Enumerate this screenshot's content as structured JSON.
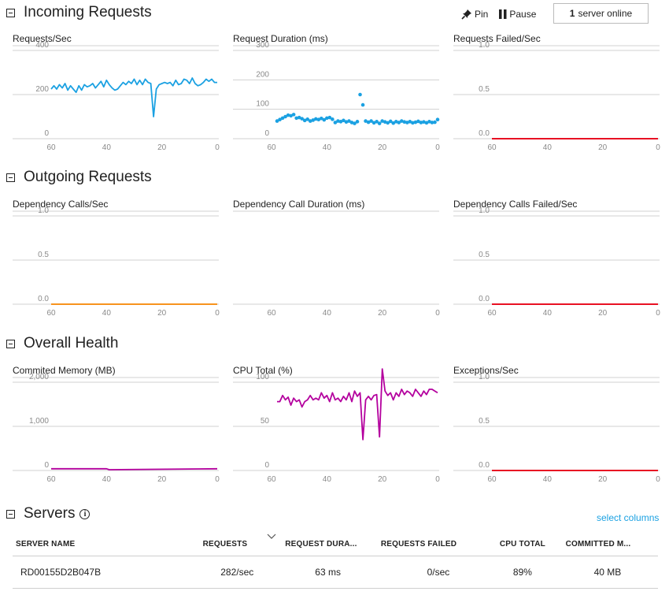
{
  "sections": {
    "incoming": "Incoming Requests",
    "outgoing": "Outgoing Requests",
    "health": "Overall Health",
    "servers": "Servers"
  },
  "toolbar": {
    "pin_label": "Pin",
    "pause_label": "Pause",
    "server_count": "1",
    "server_text": "server online"
  },
  "servers_panel": {
    "info_icon": "i",
    "select_columns": "select columns",
    "columns": [
      "SERVER NAME",
      "REQUESTS",
      "REQUEST DURA...",
      "REQUESTS FAILED",
      "CPU TOTAL",
      "COMMITTED M..."
    ],
    "rows": [
      [
        "RD00155D2B047B",
        "282/sec",
        "63 ms",
        "0/sec",
        "89%",
        "40 MB"
      ]
    ]
  },
  "colors": {
    "blue": "#1ba1e2",
    "orange": "#f7931e",
    "red": "#e81123",
    "purple": "#b4009e"
  },
  "chart_data": [
    {
      "id": "req-sec",
      "type": "line",
      "title": "Requests/Sec",
      "color": "#1ba1e2",
      "yticks": [
        "400",
        "200",
        "0"
      ],
      "ytick_values": [
        400,
        200,
        0
      ],
      "ylim": [
        0,
        400
      ],
      "xticks": [
        "60",
        "40",
        "20",
        "0"
      ],
      "xlim": [
        60,
        0
      ],
      "x": [
        60,
        59,
        58,
        57,
        56,
        55,
        54,
        53,
        52,
        51,
        50,
        49,
        48,
        47,
        46,
        45,
        44,
        43,
        42,
        41,
        40,
        39,
        38,
        37,
        36,
        35,
        34,
        33,
        32,
        31,
        30,
        29,
        28,
        27,
        26,
        25,
        24,
        23,
        22,
        21,
        20,
        19,
        18,
        17,
        16,
        15,
        14,
        13,
        12,
        11,
        10,
        9,
        8,
        7,
        6,
        5,
        4,
        3,
        2,
        1,
        0
      ],
      "values": [
        225,
        240,
        225,
        245,
        230,
        250,
        220,
        240,
        225,
        210,
        240,
        220,
        245,
        235,
        240,
        250,
        230,
        245,
        260,
        235,
        265,
        245,
        230,
        220,
        225,
        240,
        255,
        245,
        260,
        250,
        270,
        245,
        265,
        245,
        270,
        255,
        250,
        100,
        225,
        245,
        250,
        255,
        250,
        255,
        240,
        265,
        245,
        250,
        270,
        265,
        250,
        275,
        250,
        240,
        245,
        255,
        270,
        260,
        270,
        255,
        255
      ]
    },
    {
      "id": "req-dur",
      "type": "scatter",
      "title": "Request Duration (ms)",
      "color": "#1ba1e2",
      "yticks": [
        "300",
        "200",
        "100",
        "0"
      ],
      "ytick_values": [
        300,
        200,
        100,
        0
      ],
      "ylim": [
        0,
        300
      ],
      "xticks": [
        "60",
        "40",
        "20",
        "0"
      ],
      "xlim": [
        60,
        0
      ],
      "x": [
        58,
        57,
        56,
        55,
        54,
        53,
        52,
        51,
        50,
        49,
        48,
        47,
        46,
        45,
        44,
        43,
        42,
        41,
        40,
        39,
        38,
        37,
        36,
        35,
        34,
        33,
        32,
        31,
        30,
        29,
        28,
        27,
        26,
        25,
        24,
        23,
        22,
        21,
        20,
        19,
        18,
        17,
        16,
        15,
        14,
        13,
        12,
        11,
        10,
        9,
        8,
        7,
        6,
        5,
        4,
        3,
        2,
        1,
        0
      ],
      "values": [
        60,
        65,
        70,
        75,
        80,
        78,
        82,
        70,
        72,
        68,
        62,
        66,
        60,
        63,
        67,
        65,
        69,
        64,
        70,
        72,
        66,
        55,
        60,
        58,
        62,
        57,
        60,
        55,
        52,
        58,
        150,
        115,
        60,
        56,
        60,
        54,
        58,
        52,
        60,
        57,
        54,
        59,
        53,
        58,
        55,
        60,
        57,
        55,
        58,
        54,
        56,
        59,
        55,
        57,
        54,
        58,
        55,
        56,
        65
      ]
    },
    {
      "id": "req-failed",
      "type": "line",
      "title": "Requests Failed/Sec",
      "color": "#e81123",
      "yticks": [
        "1.0",
        "0.5",
        "0.0"
      ],
      "ytick_values": [
        1,
        0.5,
        0
      ],
      "ylim": [
        0,
        1
      ],
      "xticks": [
        "60",
        "40",
        "20",
        "0"
      ],
      "xlim": [
        60,
        0
      ],
      "x": [
        60,
        0
      ],
      "values": [
        0,
        0
      ]
    },
    {
      "id": "dep-calls",
      "type": "line",
      "title": "Dependency Calls/Sec",
      "color": "#f7931e",
      "yticks": [
        "1.0",
        "0.5",
        "0.0"
      ],
      "ytick_values": [
        1,
        0.5,
        0
      ],
      "ylim": [
        0,
        1
      ],
      "xticks": [
        "60",
        "40",
        "20",
        "0"
      ],
      "xlim": [
        60,
        0
      ],
      "x": [
        60,
        0
      ],
      "values": [
        0,
        0
      ]
    },
    {
      "id": "dep-dur",
      "type": "line",
      "title": "Dependency Call Duration (ms)",
      "color": "#1ba1e2",
      "yticks": [],
      "ytick_values": [],
      "ylim": [
        0,
        1
      ],
      "xticks": [
        "60",
        "40",
        "20",
        "0"
      ],
      "xlim": [
        60,
        0
      ],
      "x": [],
      "values": []
    },
    {
      "id": "dep-failed",
      "type": "line",
      "title": "Dependency Calls Failed/Sec",
      "color": "#e81123",
      "yticks": [
        "1.0",
        "0.5",
        "0.0"
      ],
      "ytick_values": [
        1,
        0.5,
        0
      ],
      "ylim": [
        0,
        1
      ],
      "xticks": [
        "60",
        "40",
        "20",
        "0"
      ],
      "xlim": [
        60,
        0
      ],
      "x": [
        60,
        0
      ],
      "values": [
        0,
        0
      ]
    },
    {
      "id": "mem",
      "type": "line",
      "title": "Commited Memory (MB)",
      "color": "#b4009e",
      "yticks": [
        "2,000",
        "1,000",
        "0"
      ],
      "ytick_values": [
        2000,
        1000,
        0
      ],
      "ylim": [
        0,
        2000
      ],
      "xticks": [
        "60",
        "40",
        "20",
        "0"
      ],
      "xlim": [
        60,
        0
      ],
      "x": [
        60,
        40,
        39,
        0
      ],
      "values": [
        40,
        40,
        18,
        40
      ]
    },
    {
      "id": "cpu",
      "type": "line",
      "title": "CPU Total (%)",
      "color": "#b4009e",
      "yticks": [
        "100",
        "50",
        "0"
      ],
      "ytick_values": [
        100,
        50,
        0
      ],
      "ylim": [
        0,
        100
      ],
      "xticks": [
        "60",
        "40",
        "20",
        "0"
      ],
      "xlim": [
        60,
        0
      ],
      "x": [
        58,
        57,
        56,
        55,
        54,
        53,
        52,
        51,
        50,
        49,
        48,
        47,
        46,
        45,
        44,
        43,
        42,
        41,
        40,
        39,
        38,
        37,
        36,
        35,
        34,
        33,
        32,
        31,
        30,
        29,
        28,
        27,
        26,
        25,
        24,
        23,
        22,
        21,
        20,
        19,
        18,
        17,
        16,
        15,
        14,
        13,
        12,
        11,
        10,
        9,
        8,
        7,
        6,
        5,
        4,
        3,
        2,
        1,
        0
      ],
      "values": [
        78,
        78,
        85,
        80,
        83,
        74,
        82,
        78,
        80,
        72,
        78,
        80,
        85,
        80,
        82,
        80,
        88,
        82,
        85,
        78,
        88,
        80,
        82,
        78,
        84,
        80,
        88,
        78,
        90,
        84,
        88,
        35,
        80,
        84,
        80,
        85,
        86,
        38,
        115,
        90,
        85,
        88,
        80,
        88,
        84,
        92,
        86,
        90,
        88,
        84,
        92,
        88,
        84,
        90,
        86,
        92,
        92,
        90,
        88
      ]
    },
    {
      "id": "exc",
      "type": "line",
      "title": "Exceptions/Sec",
      "color": "#e81123",
      "yticks": [
        "1.0",
        "0.5",
        "0.0"
      ],
      "ytick_values": [
        1,
        0.5,
        0
      ],
      "ylim": [
        0,
        1
      ],
      "xticks": [
        "60",
        "40",
        "20",
        "0"
      ],
      "xlim": [
        60,
        0
      ],
      "x": [
        60,
        0
      ],
      "values": [
        0,
        0
      ]
    }
  ]
}
